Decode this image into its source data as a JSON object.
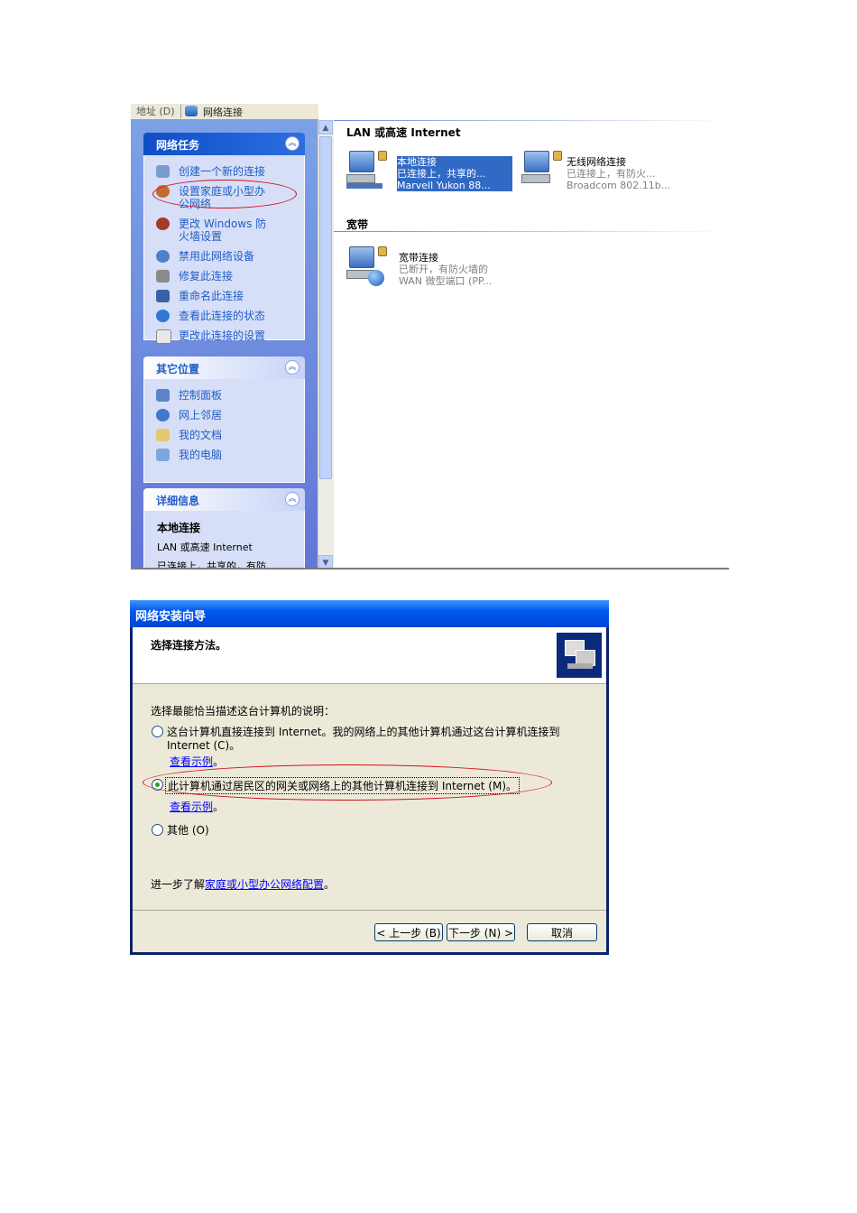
{
  "explorer": {
    "address_label": "地址 (D)",
    "address_value": "网络连接",
    "network_tasks": {
      "title": "网络任务",
      "items": [
        "创建一个新的连接",
        "设置家庭或小型办公网络",
        "更改 Windows 防火墙设置",
        "禁用此网络设备",
        "修复此连接",
        "重命名此连接",
        "查看此连接的状态",
        "更改此连接的设置"
      ]
    },
    "other_places": {
      "title": "其它位置",
      "items": [
        "控制面板",
        "网上邻居",
        "我的文档",
        "我的电脑"
      ]
    },
    "details": {
      "title": "详细信息",
      "name": "本地连接",
      "type": "LAN 或高速 Internet",
      "status": "已连接上，共享的，有防"
    },
    "groups": {
      "lan": "LAN 或高速 Internet",
      "broadband": "宽带"
    },
    "connections": {
      "local": {
        "name": "本地连接",
        "status": "已连接上，共享的...",
        "device": "Marvell Yukon 88..."
      },
      "wireless": {
        "name": "无线网络连接",
        "status": "已连接上，有防火...",
        "device": "Broadcom 802.11b..."
      },
      "broadband": {
        "name": "宽带连接",
        "status": "已断开，有防火墙的",
        "device": "WAN 微型端口 (PP..."
      }
    }
  },
  "wizard": {
    "title": "网络安装向导",
    "heading": "选择连接方法。",
    "prompt": "选择最能恰当描述这台计算机的说明：",
    "option1_line1": "这台计算机直接连接到 Internet。我的网络上的其他计算机通过这台计算机连接到",
    "option1_line2": "Internet (C)。",
    "example1": "查看示例",
    "option2": "此计算机通过居民区的网关或网络上的其他计算机连接到 Internet (M)。",
    "example2": "查看示例",
    "option3": "其他 (O)",
    "more_prefix": "进一步了解",
    "more_link": "家庭或小型办公网络配置",
    "period": "。",
    "back_button": "< 上一步 (B)",
    "next_button": "下一步 (N) >",
    "cancel_button": "取消"
  },
  "colors": {
    "xp_blue": "#0058ee",
    "task_link": "#215dc6",
    "annotation_red": "#d01020",
    "selection": "#316ac5"
  }
}
